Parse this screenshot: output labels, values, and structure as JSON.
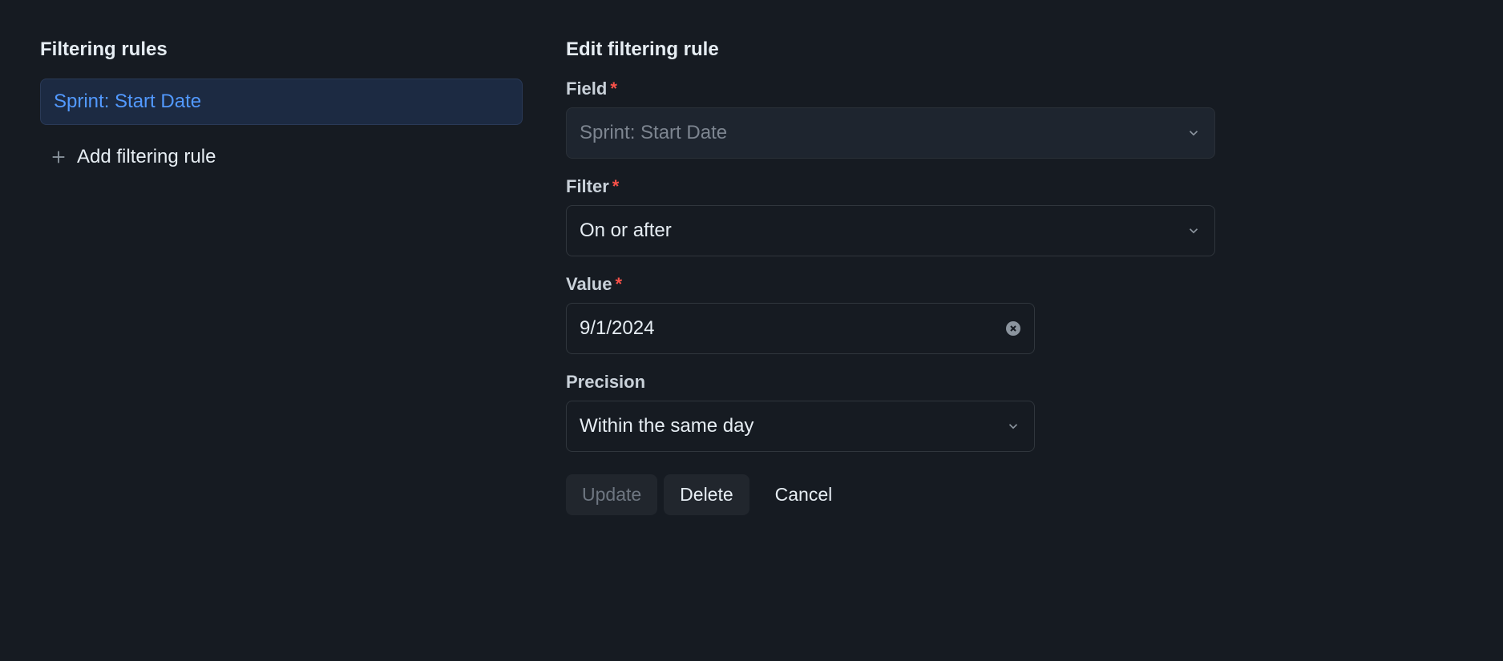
{
  "left": {
    "title": "Filtering rules",
    "rules": [
      {
        "label": "Sprint: Start Date"
      }
    ],
    "add_label": "Add filtering rule"
  },
  "right": {
    "title": "Edit filtering rule",
    "field": {
      "label": "Field",
      "value": "Sprint: Start Date"
    },
    "filter": {
      "label": "Filter",
      "value": "On or after"
    },
    "value": {
      "label": "Value",
      "value": "9/1/2024"
    },
    "precision": {
      "label": "Precision",
      "value": "Within the same day"
    },
    "actions": {
      "update": "Update",
      "delete": "Delete",
      "cancel": "Cancel"
    }
  }
}
